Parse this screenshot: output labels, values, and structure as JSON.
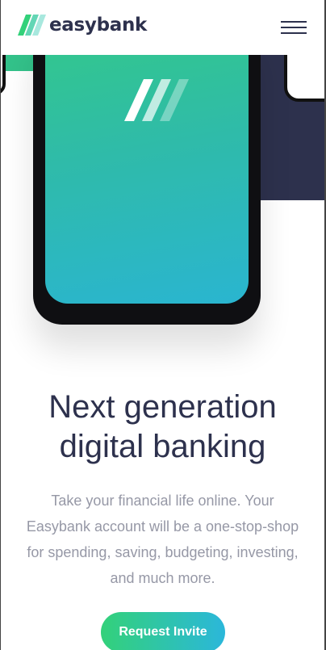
{
  "header": {
    "logo_text": "easybank",
    "logo_icon": "easybank-logo-icon",
    "menu_icon": "hamburger-icon"
  },
  "hero": {
    "phone_icon": "easybank-logo-icon",
    "headline": "Next generation digital banking",
    "subtext": "Take your financial life online. Your Easybank account will be a one-stop-shop for spending, saving, budgeting, investing, and much more.",
    "cta_label": "Request Invite"
  },
  "colors": {
    "navy": "#2d314d",
    "green": "#31d35c",
    "cyan": "#2bb7da",
    "gray_text": "#9698a6"
  }
}
